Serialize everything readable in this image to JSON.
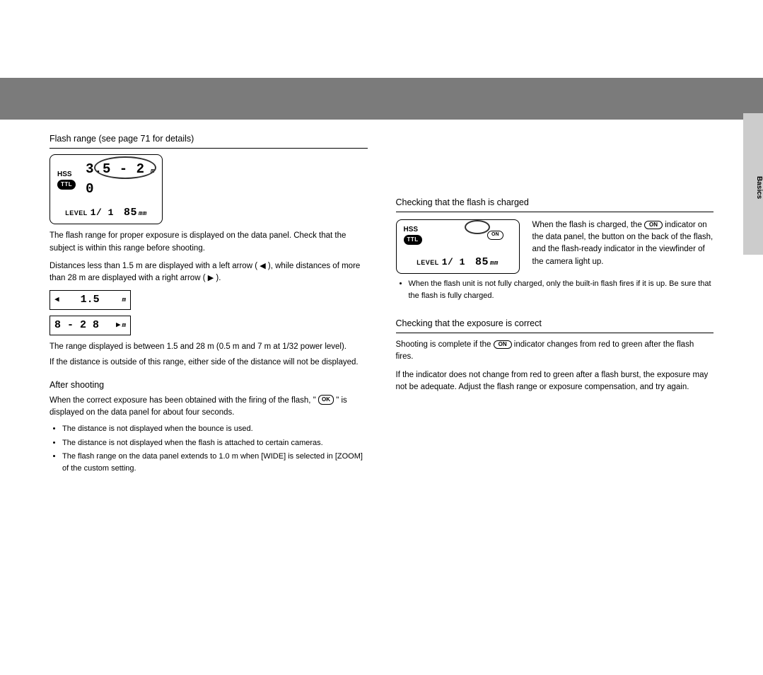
{
  "sideTab": {
    "label": "Basics"
  },
  "left": {
    "section1": {
      "heading": "Flash range (see page 71 for details)",
      "lcd": {
        "hss": "HSS",
        "ttl": "TTL",
        "range": "3.5 - 2 0",
        "rangeUnit": "m",
        "level": "LEVEL",
        "ratio": "1/ 1",
        "zoom": "85",
        "zoomUnit": "mm"
      },
      "para1": "The flash range for proper exposure is displayed on the data panel. Check that the subject is within this range before shooting.",
      "para2a": "Distances less than 1.5 m are displayed with a left arrow (",
      "arrow_left_left": "◀",
      "para2b": " ), while distances of more than 28 m are displayed with a right arrow ( ",
      "arrow_right_right": "▶",
      "para2c": " )."
    },
    "smallbox1": {
      "arrow": "◀",
      "value": "1.5",
      "unit": "m"
    },
    "smallbox2": {
      "value": "8 - 2 8",
      "arrow": "▶",
      "unit": "m"
    },
    "section2": {
      "lead1": "The range displayed is between 1.5 and 28 m (0.5 m and 7 m at 1/32 power level).",
      "lead2": "If the distance is outside of this range, either side of the distance will not be displayed.",
      "afterHead": "After shooting",
      "afterP1a": "When the correct exposure has been obtained with the firing of the flash, \"",
      "okBadge": "OK",
      "afterP1b": "\" is displayed on the data panel for about four seconds.",
      "bullets": [
        "The distance is not displayed when the bounce is used.",
        "The distance is not displayed when the flash is attached to certain cameras.",
        "The flash range on the data panel extends to 1.0 m when [WIDE] is selected in [ZOOM] of the custom setting."
      ]
    }
  },
  "right": {
    "section1": {
      "heading": "Checking that the flash is charged",
      "toppad": "",
      "lcd": {
        "hss": "HSS",
        "on": "ON",
        "ttl": "TTL",
        "level": "LEVEL",
        "ratio": "1/ 1",
        "zoom": "85",
        "zoomUnit": "mm"
      },
      "p1a": "When the flash is charged, the ",
      "onBadge1": "ON",
      "p1b": " indicator on the data panel, the button on the back of the flash, and the flash-ready indicator in the viewfinder of the camera light up.",
      "bullets": [
        "When the flash unit is not fully charged, only the built-in flash fires if it is up. Be sure that the flash is fully charged."
      ]
    },
    "section2": {
      "heading": "Checking that the exposure is correct",
      "p1a": "Shooting is complete if the ",
      "onBadge2": "ON",
      "p1b": " indicator changes from red to green after the flash fires.",
      "p2": "If the indicator does not change from red to green after a flash burst, the exposure may not be adequate. Adjust the flash range or exposure compensation, and try again."
    }
  }
}
